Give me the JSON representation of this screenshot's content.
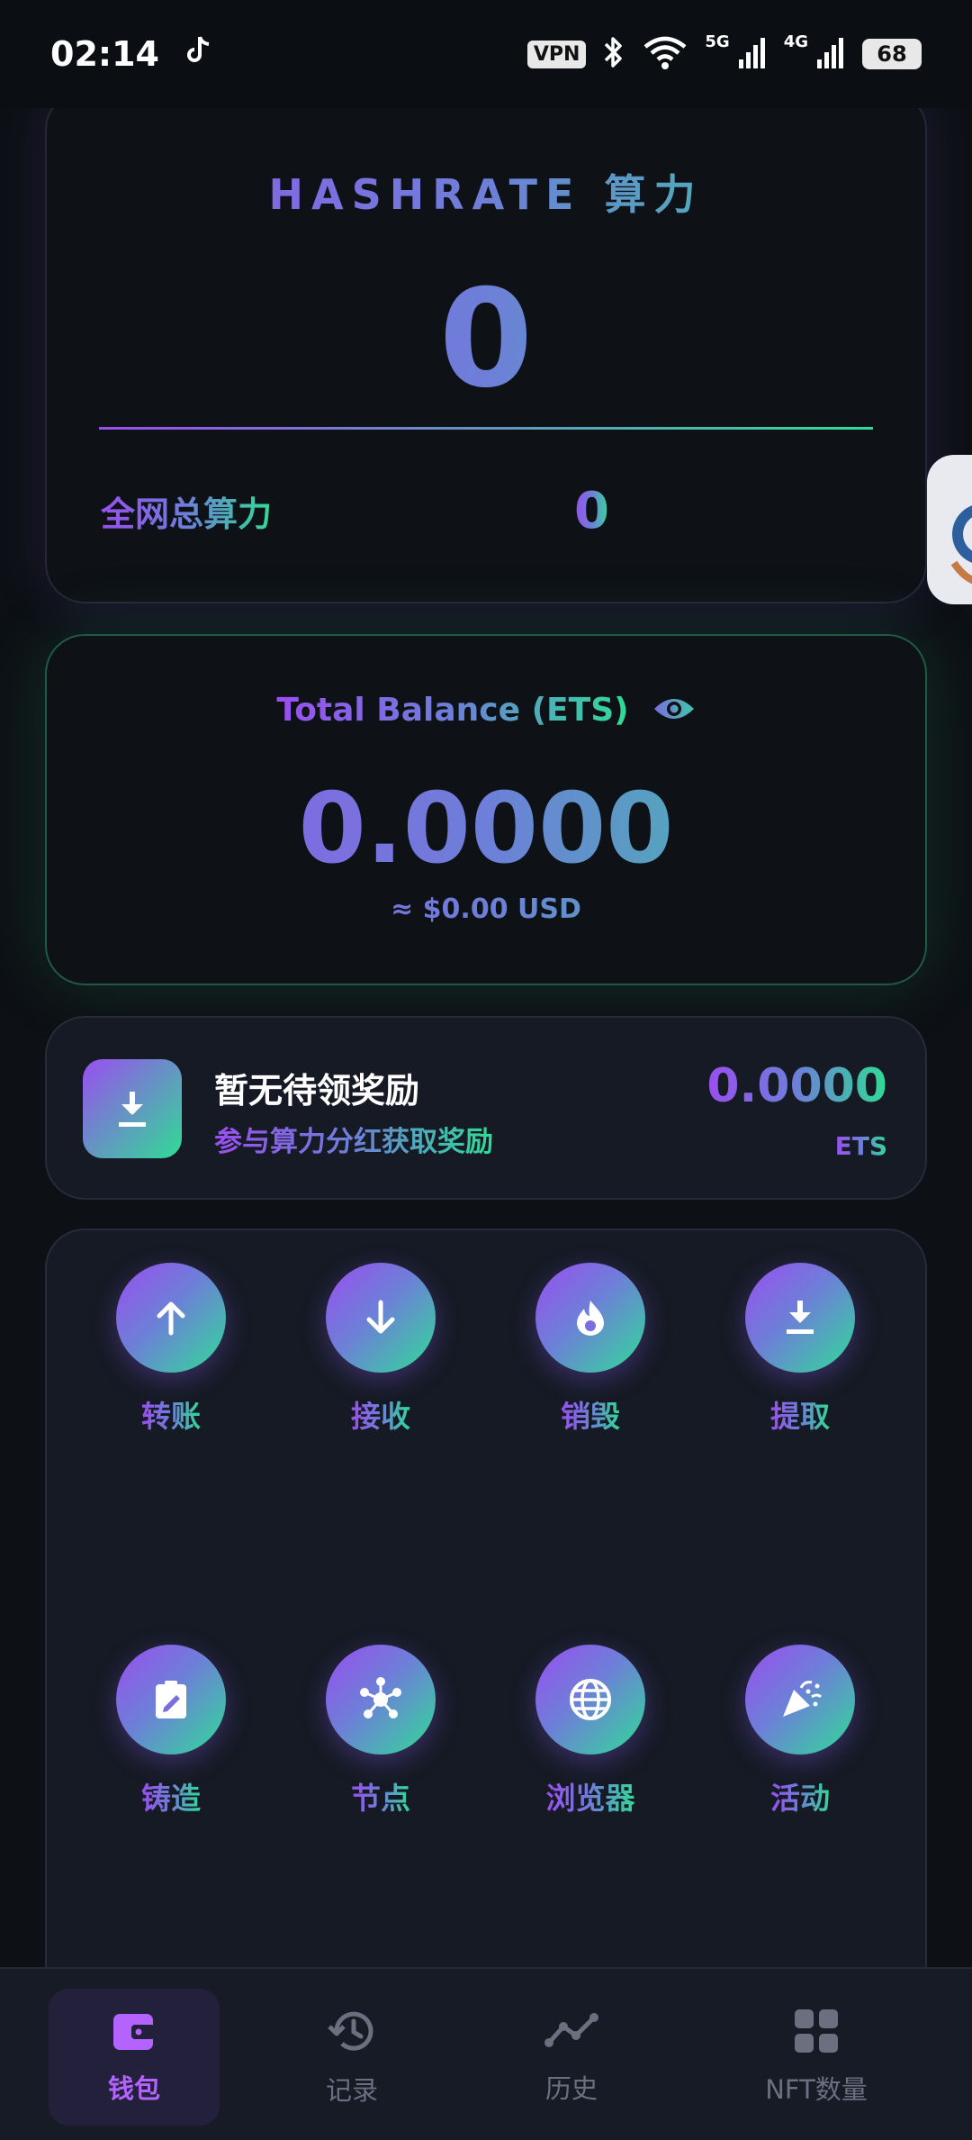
{
  "status_bar": {
    "time": "02:14",
    "vpn": "VPN",
    "net1": "5G",
    "net2": "4G",
    "battery": "68"
  },
  "hashrate": {
    "title": "HASHRATE 算力",
    "value": "0",
    "network_total_label": "全网总算力",
    "network_total_value": "0"
  },
  "balance": {
    "label": "Total Balance (ETS)",
    "value": "0.0000",
    "usd": "≈ $0.00 USD"
  },
  "reward": {
    "title": "暂无待领奖励",
    "subtitle": "参与算力分红获取奖励",
    "amount": "0.0000",
    "unit": "ETS"
  },
  "actions": [
    {
      "label": "转账",
      "icon": "arrow-up-icon"
    },
    {
      "label": "接收",
      "icon": "arrow-down-icon"
    },
    {
      "label": "销毁",
      "icon": "fire-icon"
    },
    {
      "label": "提取",
      "icon": "download-icon"
    },
    {
      "label": "铸造",
      "icon": "edit-clipboard-icon"
    },
    {
      "label": "节点",
      "icon": "network-nodes-icon"
    },
    {
      "label": "浏览器",
      "icon": "globe-icon"
    },
    {
      "label": "活动",
      "icon": "party-icon"
    }
  ],
  "bottom_nav": [
    {
      "label": "钱包",
      "icon": "wallet-icon",
      "active": true
    },
    {
      "label": "记录",
      "icon": "history-icon",
      "active": false
    },
    {
      "label": "历史",
      "icon": "trend-icon",
      "active": false
    },
    {
      "label": "NFT数量",
      "icon": "grid-icon",
      "active": false
    }
  ],
  "colors": {
    "background": "#0d1014",
    "gradient_start": "#9a4ef0",
    "gradient_end": "#2fdc96",
    "active_nav": "#b463ff"
  }
}
